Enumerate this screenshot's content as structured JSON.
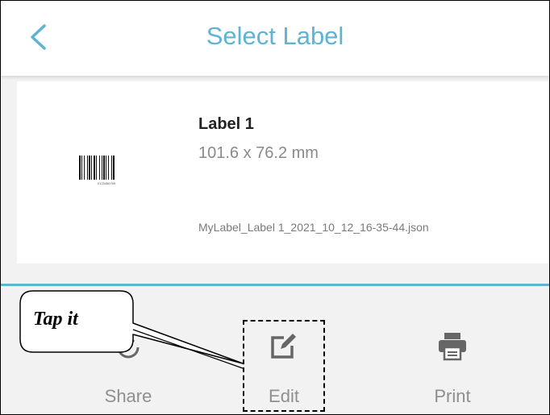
{
  "header": {
    "title": "Select Label",
    "back_icon": "chevron-left-icon"
  },
  "label_card": {
    "name": "Label 1",
    "size": "101.6 x 76.2 mm",
    "file": "MyLabel_Label 1_2021_10_12_16-35-44.json",
    "barcode_caption": "0123456789"
  },
  "actions": [
    {
      "label": "Share",
      "icon": "share-icon"
    },
    {
      "label": "Edit",
      "icon": "edit-icon"
    },
    {
      "label": "Print",
      "icon": "printer-icon"
    }
  ],
  "annotation": {
    "callout_text": "Tap it"
  },
  "colors": {
    "accent": "#5fb3d3",
    "icon_gray": "#666666",
    "text_gray": "#8f8f8f"
  }
}
